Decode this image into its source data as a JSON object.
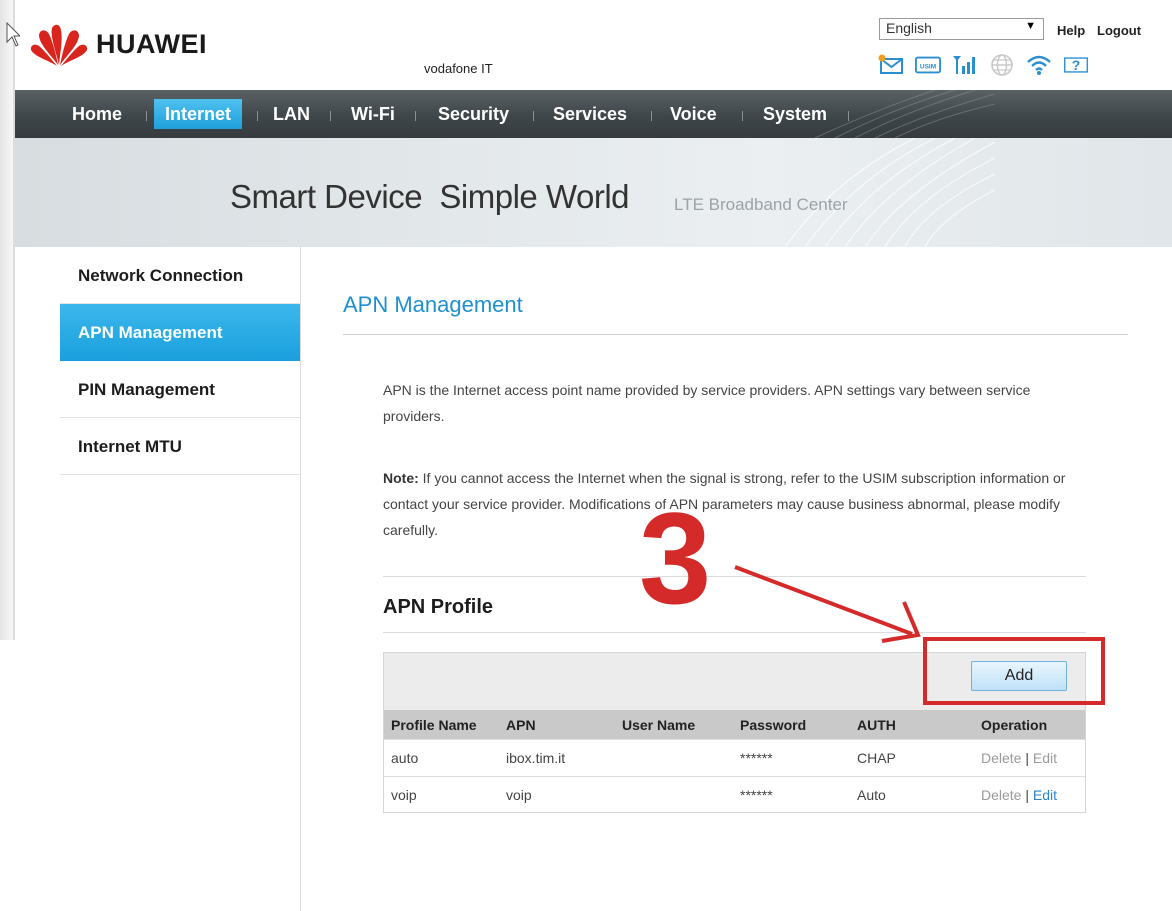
{
  "header": {
    "brand": "HUAWEI",
    "operator": "vodafone IT",
    "language": "English",
    "help": "Help",
    "logout": "Logout",
    "status_icons": [
      "mail-icon",
      "usim-icon",
      "signal-icon",
      "globe-icon",
      "wifi-icon",
      "help-icon"
    ],
    "usim_label": "USIM"
  },
  "nav": {
    "items": [
      {
        "label": "Home",
        "active": false
      },
      {
        "label": "Internet",
        "active": true
      },
      {
        "label": "LAN",
        "active": false
      },
      {
        "label": "Wi-Fi",
        "active": false
      },
      {
        "label": "Security",
        "active": false
      },
      {
        "label": "Services",
        "active": false
      },
      {
        "label": "Voice",
        "active": false
      },
      {
        "label": "System",
        "active": false
      }
    ]
  },
  "banner": {
    "slogan": "Smart Device  Simple World",
    "sub": "LTE Broadband Center"
  },
  "sidebar": {
    "items": [
      {
        "label": "Network Connection",
        "active": false
      },
      {
        "label": "APN Management",
        "active": true
      },
      {
        "label": "PIN Management",
        "active": false
      },
      {
        "label": "Internet MTU",
        "active": false
      }
    ]
  },
  "main": {
    "title": "APN Management",
    "intro": "APN is the Internet access point name provided by service providers. APN settings vary between service providers.",
    "note_label": "Note:",
    "note_text": " If you cannot access the Internet when the signal is strong, refer to the USIM subscription information or contact your service provider. Modifications of APN parameters may cause business abnormal, please modify carefully.",
    "section_title": "APN Profile",
    "add_label": "Add",
    "columns": [
      "Profile Name",
      "APN",
      "User Name",
      "Password",
      "AUTH",
      "Operation"
    ],
    "rows": [
      {
        "profile": "auto",
        "apn": "ibox.tim.it",
        "user": "",
        "password": "******",
        "auth": "CHAP",
        "delete": "Delete",
        "edit": "Edit"
      },
      {
        "profile": "voip",
        "apn": "voip",
        "user": "",
        "password": "******",
        "auth": "Auto",
        "delete": "Delete",
        "edit": "Edit"
      }
    ]
  },
  "annotation": {
    "step": "3",
    "color": "#d42a2a"
  },
  "colors": {
    "accent": "#1fa0dc",
    "nav_bg": "#3f4649",
    "title_blue": "#1f8fd0"
  }
}
